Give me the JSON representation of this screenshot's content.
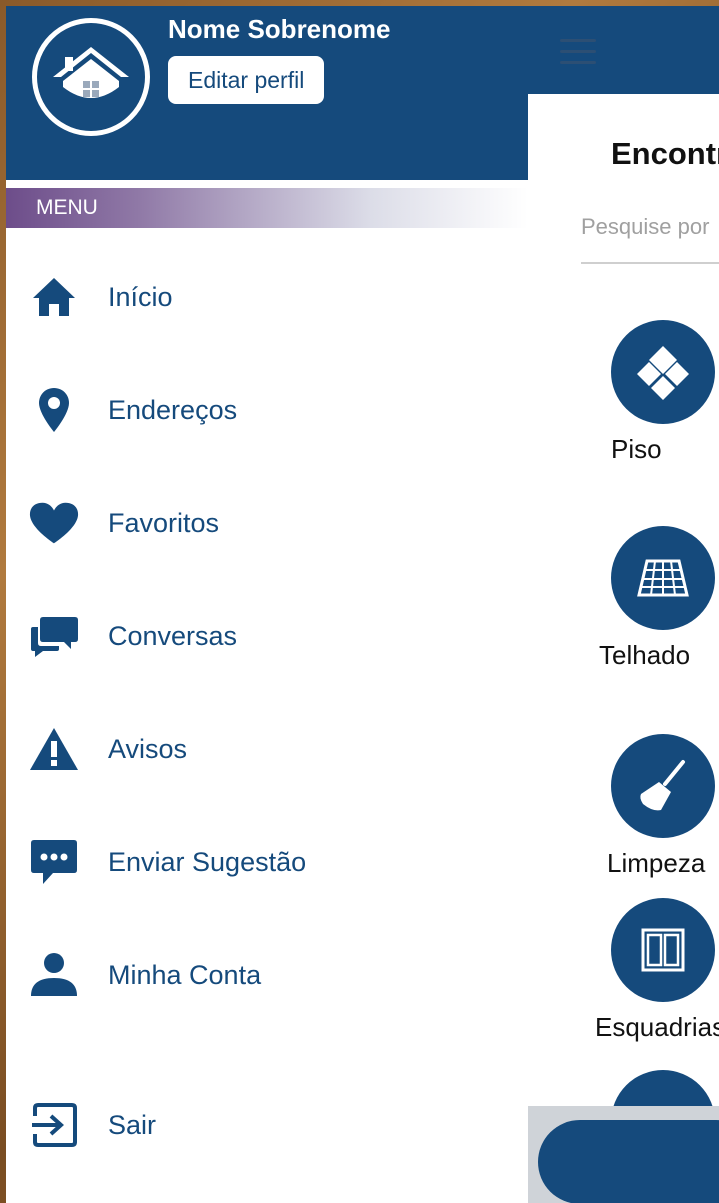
{
  "drawer": {
    "user_name": "Nome Sobrenome",
    "edit_profile_label": "Editar perfil",
    "menu_header": "MENU",
    "items": [
      {
        "label": "Início",
        "icon": "home-icon"
      },
      {
        "label": "Endereços",
        "icon": "map-pin-icon"
      },
      {
        "label": "Favoritos",
        "icon": "heart-icon"
      },
      {
        "label": "Conversas",
        "icon": "chat-bubbles-icon"
      },
      {
        "label": "Avisos",
        "icon": "warning-icon"
      },
      {
        "label": "Enviar Sugestão",
        "icon": "message-dots-icon"
      },
      {
        "label": "Minha Conta",
        "icon": "person-icon"
      }
    ],
    "logout_label": "Sair"
  },
  "main": {
    "title": "Encontre",
    "search_placeholder": "Pesquise por",
    "categories": [
      {
        "label": "Piso",
        "icon": "tiles-icon"
      },
      {
        "label": "Telhado",
        "icon": "roof-icon"
      },
      {
        "label": "Limpeza",
        "icon": "broom-icon"
      },
      {
        "label": "Esquadrias",
        "icon": "window-icon"
      }
    ]
  },
  "colors": {
    "primary": "#154a7c",
    "menu_gradient_start": "#6d4d8a",
    "wood_frame": "#a06a34"
  }
}
